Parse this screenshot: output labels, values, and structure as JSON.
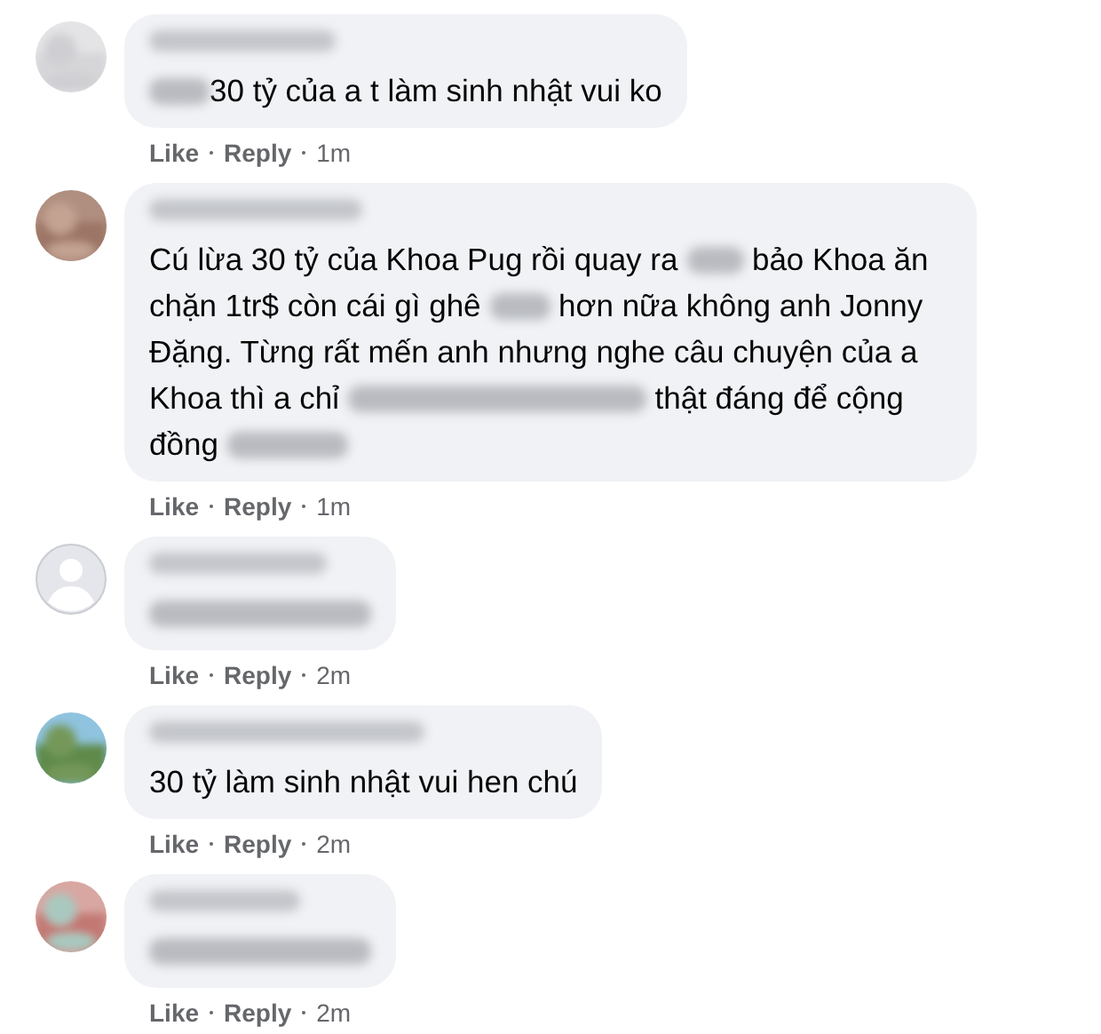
{
  "comments": [
    {
      "avatar": {
        "kind": "picture"
      },
      "body": [
        {
          "kind": "blur"
        },
        {
          "kind": "text",
          "text": "30 tỷ của a t làm sinh nhật vui ko"
        }
      ],
      "actions": [
        {
          "kind": "link",
          "label": "Like"
        },
        {
          "kind": "link",
          "label": "Reply"
        },
        {
          "kind": "time",
          "label": "1m"
        }
      ]
    },
    {
      "avatar": {
        "kind": "picture"
      },
      "body": [
        {
          "kind": "text",
          "text": "Cú lừa 30 tỷ của Khoa Pug rồi quay ra "
        },
        {
          "kind": "blur"
        },
        {
          "kind": "text",
          "text": " bảo Khoa ăn chặn 1tr$ còn cái gì ghê "
        },
        {
          "kind": "blur"
        },
        {
          "kind": "text",
          "text": " hơn nữa không anh Jonny Đặng. Từng rất mến anh nhưng nghe câu chuyện của a Khoa thì a chỉ "
        },
        {
          "kind": "blur"
        },
        {
          "kind": "text",
          "text": " thật đáng để cộng đồng "
        },
        {
          "kind": "blur"
        }
      ],
      "actions": [
        {
          "kind": "link",
          "label": "Like"
        },
        {
          "kind": "link",
          "label": "Reply"
        },
        {
          "kind": "time",
          "label": "1m"
        }
      ]
    },
    {
      "avatar": {
        "kind": "default"
      },
      "body": [
        {
          "kind": "blur"
        }
      ],
      "actions": [
        {
          "kind": "link",
          "label": "Like"
        },
        {
          "kind": "link",
          "label": "Reply"
        },
        {
          "kind": "time",
          "label": "2m"
        }
      ]
    },
    {
      "avatar": {
        "kind": "picture"
      },
      "body": [
        {
          "kind": "text",
          "text": "30 tỷ làm sinh nhật vui hen chú"
        }
      ],
      "actions": [
        {
          "kind": "link",
          "label": "Like"
        },
        {
          "kind": "link",
          "label": "Reply"
        },
        {
          "kind": "time",
          "label": "2m"
        }
      ]
    },
    {
      "avatar": {
        "kind": "picture"
      },
      "body": [
        {
          "kind": "blur"
        }
      ],
      "actions": [
        {
          "kind": "link",
          "label": "Like"
        },
        {
          "kind": "link",
          "label": "Reply"
        },
        {
          "kind": "time",
          "label": "2m"
        }
      ]
    }
  ]
}
